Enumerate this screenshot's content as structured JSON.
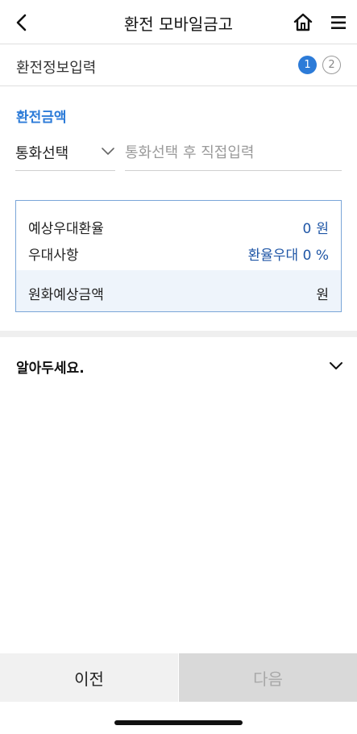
{
  "header": {
    "title": "환전 모바일금고",
    "back_icon": "chevron-left-icon",
    "home_icon": "home-icon",
    "menu_icon": "hamburger-menu-icon"
  },
  "stepbar": {
    "title": "환전정보입력",
    "steps": [
      {
        "label": "1",
        "active": true
      },
      {
        "label": "2",
        "active": false
      }
    ],
    "active_color": "#2c7bd8"
  },
  "form": {
    "section_label": "환전금액",
    "currency_select": {
      "value": "통화선택"
    },
    "amount_input": {
      "value": "",
      "placeholder": "통화선택 후 직접입력"
    }
  },
  "summary": {
    "rate": {
      "label": "예상우대환율",
      "value": "0",
      "unit": "원"
    },
    "preference": {
      "label": "우대사항",
      "prefix": "환율우대",
      "value": "0",
      "unit": "%"
    },
    "krw_estimate": {
      "label": "원화예상금액",
      "value": "",
      "unit": "원"
    },
    "value_color": "#1f56a6"
  },
  "notice": {
    "title": "알아두세요."
  },
  "footer": {
    "prev_label": "이전",
    "next_label": "다음"
  }
}
